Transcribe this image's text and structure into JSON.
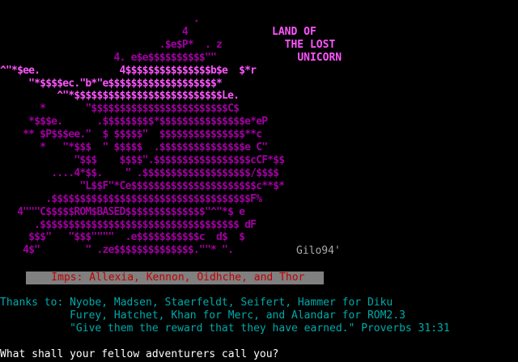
{
  "art": {
    "lines": [
      "                                  .",
      "                                4",
      "                            .$e$P*  . z",
      "                    4. e$e$$$$$$$$$$\"\"",
      "^\"*$ee.              4$$$$$$$$$$$$$$$b$e  $*r",
      "     \"*$$$$ec.\"b*\"e$$$$$$$$$$$$$$$$$$$*",
      "          ^\"*$$$$$$$$$$$$$$$$$$$$$$$$$$Le.",
      "       *       \"$$$$$$$$$$$$$$$$$$$$$$$$C$",
      "     *$$$e.      .$$$$$$$$$*$$$$$$$$$$$$$$$e*eP",
      "    ** $P$$$ee.\"  $ $$$$$\"  $$$$$$$$$$$$$$$**c",
      "       *   \"*$$$  \" $$$$$  .$$$$$$$$$$$$$$$e C\"",
      "             \"$$$    $$$$\".$$$$$$$$$$$$$$$$$cCF*$$",
      "         ....4*$$.    \" .$$$$$$$$$$$$$$$$$$$/$$$$",
      "              \"L$$F\"*Ce$$$$$$$$$$$$$$$$$$$$$$c**$*",
      "        .$$$$$$$$$$$$$$$$$$$$$$$$$$$$$$$$$$$F%",
      "   4\"\"\"C$$$$$ROM$BASED$$$$$$$$$$$$$$\"^\"*$ e",
      "      .$$$$$$$$$$$$$$$$$$$$$$$$$$$$$$$$$$$ dF",
      "     $$$\"   \"$$$\"\"\"\"  .e$$$$$$$$$$$c  d$  $",
      "    4$\"        \" .ze$$$$$$$$$$$$$$.\"\"* \".",
      ""
    ]
  },
  "title": {
    "line1": "LAND OF",
    "line2": "THE LOST",
    "line3": "UNICORN"
  },
  "signature": "Gilo94'",
  "imps": "    Imps: Allexia, Kennon, Oidhche, and Thor",
  "credits": {
    "line1": "Thanks to: Nyobe, Madsen, Staerfeldt, Seifert, Hammer for Diku",
    "line2": "           Furey, Hatchet, Khan for Merc, and Alandar for ROM2.3",
    "line3": "           \"Give them the reward that they have earned.\" Proverbs 31:31"
  },
  "prompt": "What shall your fellow adventurers call you?",
  "colors": {
    "background": "#000000",
    "art": "#aa00aa",
    "title": "#ff55ff",
    "credits": "#00aaaa",
    "imps_text": "#c00000",
    "imps_bg": "#808080",
    "prompt": "#ffffff"
  }
}
